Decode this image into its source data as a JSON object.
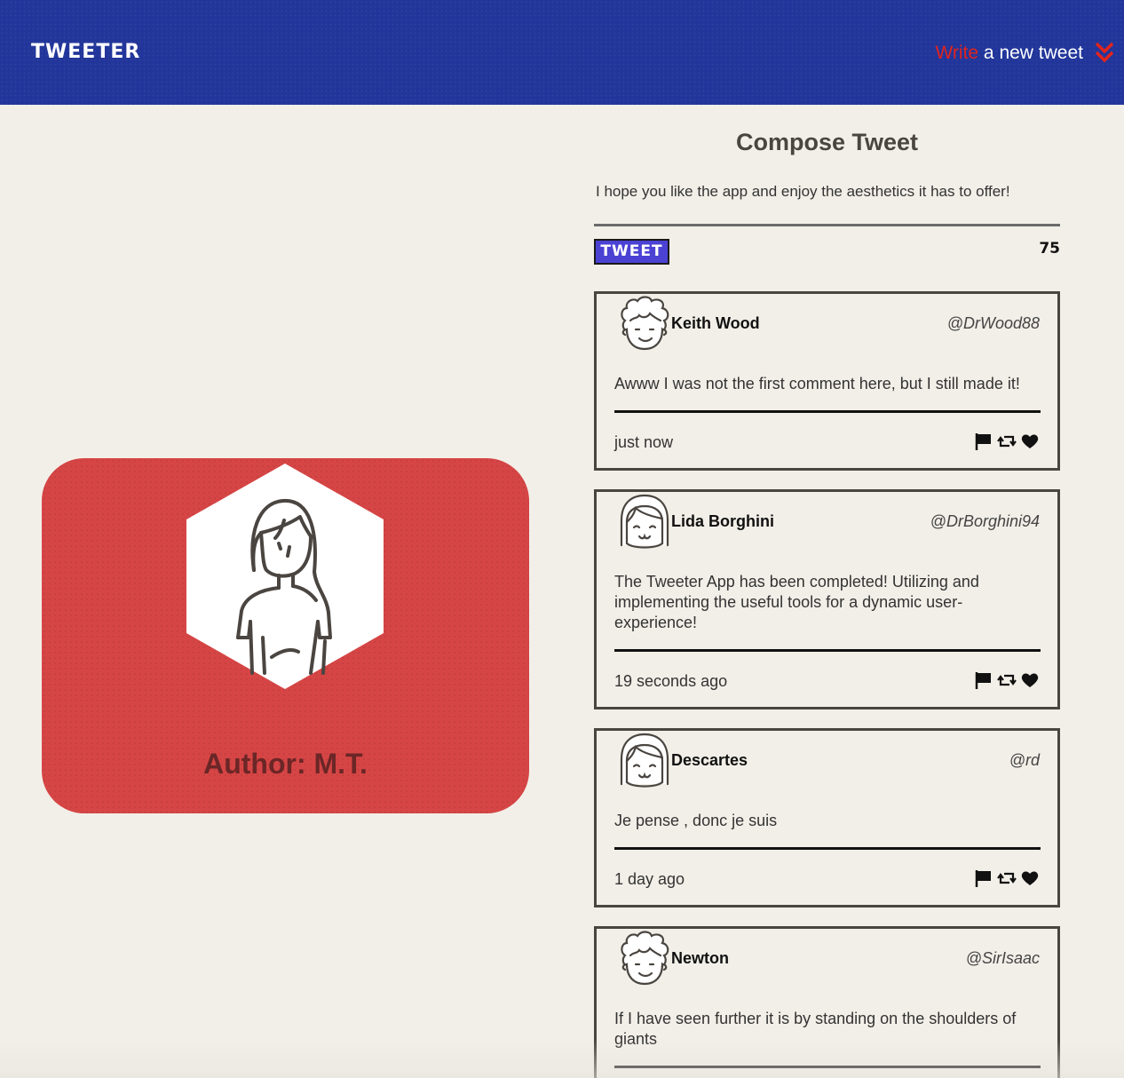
{
  "nav": {
    "brand": "TWEETER",
    "write_accent": "Write",
    "write_rest": " a new tweet",
    "chevron_icon": "double-chevron-down-icon"
  },
  "author_card": {
    "name": "Author: M.T.",
    "avatar_icon": "woman-avatar-icon",
    "bg_color": "#d64545"
  },
  "compose": {
    "title": "Compose Tweet",
    "text": "I hope you like the app and enjoy the aesthetics it has to offer!",
    "button_label": "TWEET",
    "counter": "75"
  },
  "tweets": [
    {
      "name": "Keith Wood",
      "handle": "@DrWood88",
      "body": "Awww I was not the first comment here, but I still made it!",
      "time": "just now",
      "avatar": "curly-hair-avatar-icon"
    },
    {
      "name": "Lida Borghini",
      "handle": "@DrBorghini94",
      "body": "The Tweeter App has been completed! Utilizing and implementing the useful tools for a dynamic user-experience!",
      "time": "19 seconds ago",
      "avatar": "bob-hair-avatar-icon"
    },
    {
      "name": "Descartes",
      "handle": "@rd",
      "body": "Je pense , donc je suis",
      "time": "1 day ago",
      "avatar": "bob-hair-avatar-icon"
    },
    {
      "name": "Newton",
      "handle": "@SirIsaac",
      "body": "If I have seen further it is by standing on the shoulders of giants",
      "time": "",
      "avatar": "curly-hair-avatar-icon"
    }
  ],
  "colors": {
    "nav_bg": "#21359a",
    "accent_red": "#e0241e",
    "tweet_button": "#4b42d4",
    "page_bg": "#f2efe8"
  }
}
